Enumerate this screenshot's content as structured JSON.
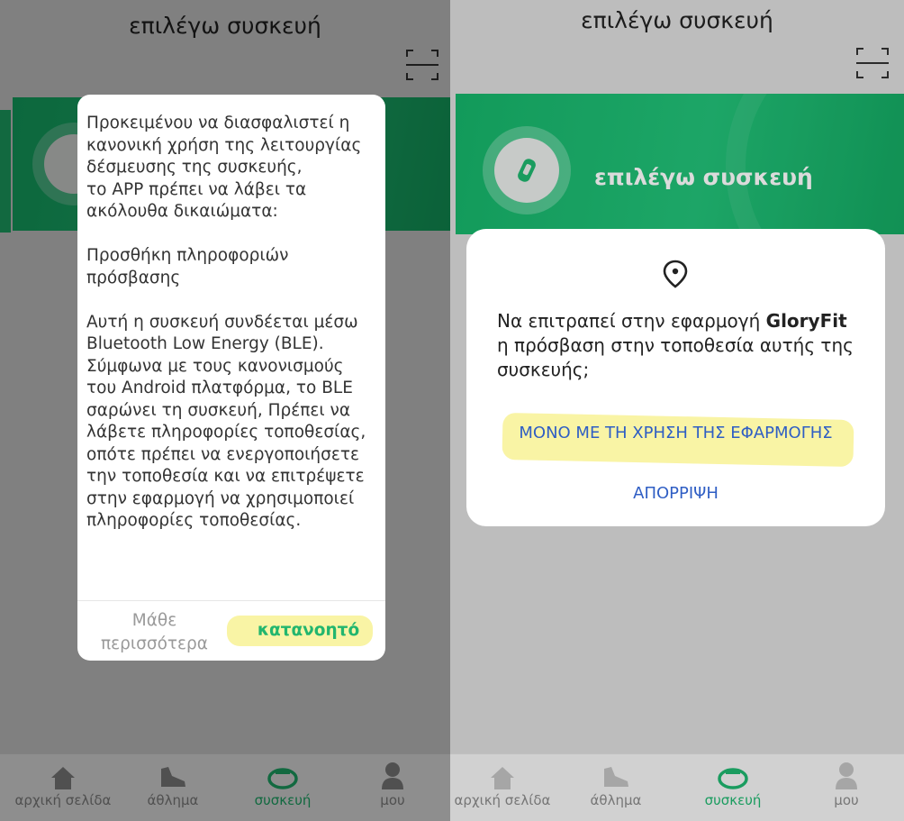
{
  "screen_title": "επιλέγω συσκευή",
  "banner": {
    "title": "επιλέγω συσκευή"
  },
  "tabs": [
    {
      "label": "αρχική σελίδα",
      "icon": "home-icon"
    },
    {
      "label": "άθλημα",
      "icon": "sneaker-icon"
    },
    {
      "label": "συσκευή",
      "icon": "watch-icon",
      "active": true
    },
    {
      "label": "μου",
      "icon": "person-icon"
    }
  ],
  "permission_dialog": {
    "text": "Προκειμένου να διασφαλιστεί η κανονική χρήση της λειτουργίας δέσμευσης της συσκευής,\nτο APP πρέπει να λάβει τα ακόλουθα δικαιώματα:\n\nΠροσθήκη πληροφοριών πρόσβασης\n\nΑυτή η συσκευή συνδέεται μέσω Bluetooth Low Energy (BLE). Σύμφωνα με τους κανονισμούς του Android πλατφόρμα, το BLE σαρώνει τη συσκευή, Πρέπει να λάβετε πληροφορίες τοποθεσίας, οπότε πρέπει να ενεργοποιήσετε την τοποθεσία και να επιτρέψετε στην εφαρμογή να χρησιμοποιεί πληροφορίες τοποθεσίας.",
    "learn_more": "Μάθε\nπερισσότερα",
    "ok": "κατανοητό"
  },
  "location_dialog": {
    "question_prefix": "Να επιτραπεί στην εφαρμογή ",
    "app_name": "GloryFit",
    "question_suffix": " η πρόσβαση στην τοποθεσία αυτής της συσκευής;",
    "allow_while_using": "ΜΟΝΟ ΜΕ ΤΗ ΧΡΗΣΗ ΤΗΣ ΕΦΑΡΜΟΓΗΣ",
    "deny": "ΑΠΟΡΡΙΨΗ"
  },
  "colors": {
    "brand_green": "#1fb66f",
    "dialog_button_blue": "#2f5ec4",
    "highlight": "#f6ee6e"
  }
}
